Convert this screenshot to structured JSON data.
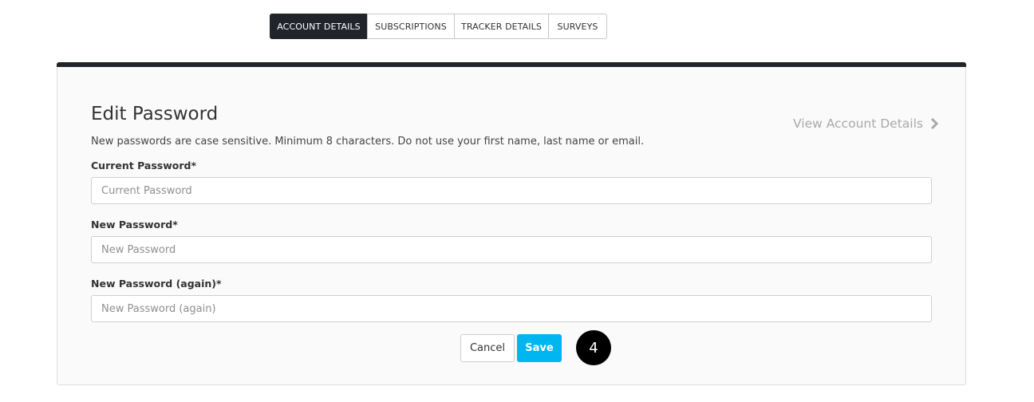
{
  "tabs": [
    {
      "label": "ACCOUNT DETAILS",
      "active": true
    },
    {
      "label": "SUBSCRIPTIONS",
      "active": false
    },
    {
      "label": "TRACKER DETAILS",
      "active": false
    },
    {
      "label": "SURVEYS",
      "active": false
    }
  ],
  "form": {
    "title": "Edit Password",
    "view_link": "View Account Details",
    "view_link_icon": "chevron-right-icon",
    "help_text": "New passwords are case sensitive. Minimum 8 characters. Do not use your first name, last name or email.",
    "fields": [
      {
        "label": "Current Password*",
        "placeholder": "Current Password",
        "value": ""
      },
      {
        "label": "New Password*",
        "placeholder": "New Password",
        "value": ""
      },
      {
        "label": "New Password (again)*",
        "placeholder": "New Password (again)",
        "value": ""
      }
    ],
    "cancel_label": "Cancel",
    "save_label": "Save"
  },
  "step_badge": "4",
  "colors": {
    "dark": "#21252b",
    "accent": "#00b6f1",
    "link_muted": "#a9a9a9"
  }
}
